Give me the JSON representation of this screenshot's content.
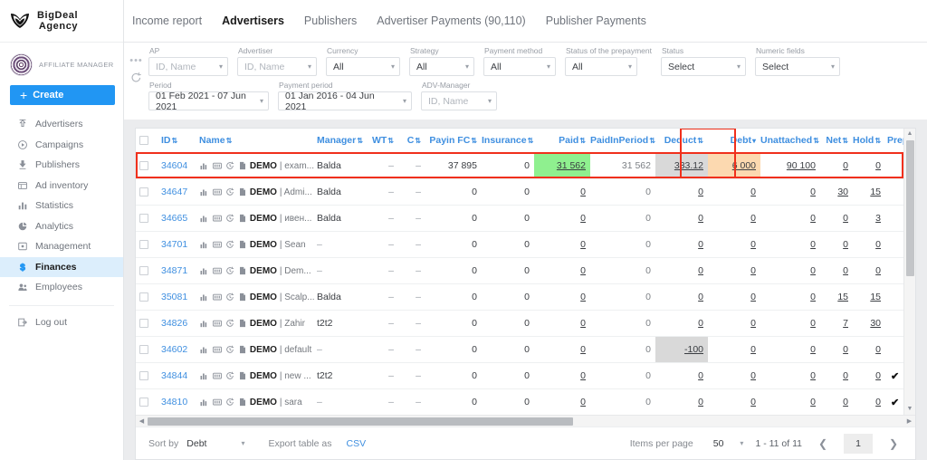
{
  "brand": {
    "line1": "BigDeal",
    "line2": "Agency",
    "logo_icon": "shield-logo-icon"
  },
  "account": {
    "role_label": "AFFILIATE MANAGER",
    "avatar_icon": "user-avatar-icon"
  },
  "sidebar": {
    "create_label": "Create",
    "items": [
      {
        "label": "Advertisers",
        "icon": "advertisers-icon"
      },
      {
        "label": "Campaigns",
        "icon": "campaigns-play-icon"
      },
      {
        "label": "Publishers",
        "icon": "publishers-icon"
      },
      {
        "label": "Ad inventory",
        "icon": "ad-inventory-icon"
      },
      {
        "label": "Statistics",
        "icon": "statistics-bars-icon"
      },
      {
        "label": "Analytics",
        "icon": "analytics-pie-icon"
      },
      {
        "label": "Management",
        "icon": "management-icon"
      },
      {
        "label": "Finances",
        "icon": "finances-dollar-icon"
      },
      {
        "label": "Employees",
        "icon": "employees-icon"
      }
    ],
    "logout_label": "Log out",
    "logout_icon": "logout-icon"
  },
  "topbar": {
    "tabs": [
      {
        "label": "Income report"
      },
      {
        "label": "Advertisers"
      },
      {
        "label": "Publishers"
      },
      {
        "label": "Advertiser Payments (90,110)"
      },
      {
        "label": "Publisher Payments"
      }
    ],
    "active_index": 1
  },
  "filters": {
    "more_icon": "three-dots-icon",
    "reset_icon": "reset-refresh-icon",
    "row1": [
      {
        "label": "AP",
        "value": "ID, Name",
        "placeholder": true,
        "w": "w-ap"
      },
      {
        "label": "Advertiser",
        "value": "ID, Name",
        "placeholder": true,
        "w": "w-adv"
      },
      {
        "label": "Currency",
        "value": "All",
        "placeholder": false,
        "w": "w-cur"
      },
      {
        "label": "Strategy",
        "value": "All",
        "placeholder": false,
        "w": "w-str"
      },
      {
        "label": "Payment method",
        "value": "All",
        "placeholder": false,
        "w": "w-pm"
      },
      {
        "label": "Status of the prepayment",
        "value": "All",
        "placeholder": false,
        "w": "w-sop"
      },
      {
        "label": "Status",
        "value": "Select",
        "placeholder": false,
        "w": "w-st"
      },
      {
        "label": "Numeric fields",
        "value": "Select",
        "placeholder": false,
        "w": "w-nf"
      }
    ],
    "row2": [
      {
        "label": "Period",
        "value": "01 Feb 2021 - 07 Jun 2021",
        "placeholder": false,
        "w": "w-per"
      },
      {
        "label": "Payment period",
        "value": "01 Jan 2016 - 04 Jun 2021",
        "placeholder": false,
        "w": "w-pper"
      },
      {
        "label": "ADV-Manager",
        "value": "ID, Name",
        "placeholder": true,
        "w": "w-adm"
      }
    ]
  },
  "table": {
    "columns": [
      {
        "key": "checkbox",
        "label": "",
        "sortable": false
      },
      {
        "key": "id",
        "label": "ID",
        "sortable": true
      },
      {
        "key": "name",
        "label": "Name",
        "sortable": true
      },
      {
        "key": "manager",
        "label": "Manager",
        "sortable": true
      },
      {
        "key": "wt",
        "label": "WT",
        "sortable": true
      },
      {
        "key": "c",
        "label": "C",
        "sortable": true
      },
      {
        "key": "payinfc",
        "label": "Payin FC",
        "sortable": true
      },
      {
        "key": "insurance",
        "label": "Insurance",
        "sortable": true
      },
      {
        "key": "paid",
        "label": "Paid",
        "sortable": true
      },
      {
        "key": "paidinper",
        "label": "PaidInPeriod",
        "sortable": true
      },
      {
        "key": "deduct",
        "label": "Deduct",
        "sortable": true
      },
      {
        "key": "debt",
        "label": "Debt",
        "sortable": "desc"
      },
      {
        "key": "unattached",
        "label": "Unattached",
        "sortable": true
      },
      {
        "key": "net",
        "label": "Net",
        "sortable": true
      },
      {
        "key": "hold",
        "label": "Hold",
        "sortable": true
      },
      {
        "key": "prepay",
        "label": "Prepay",
        "sortable": true
      }
    ],
    "row_icons": [
      "chart-bars-icon",
      "counter-box-icon",
      "history-clock-icon",
      "document-icon"
    ],
    "rows": [
      {
        "id": "34604",
        "demo": "DEMO",
        "name": "| exam...",
        "manager": "Balda",
        "wt": "–",
        "c": "–",
        "payinfc": "37 895",
        "insurance": "0",
        "paid": "31 562",
        "paidinper": "31 562",
        "deduct": "333.12",
        "debt": "6 000",
        "unattached": "90 100",
        "net": "0",
        "hold": "0",
        "prepay": "",
        "paid_bg": "green",
        "deduct_bg": "gray",
        "debt_bg": "orange",
        "highlight": true
      },
      {
        "id": "34647",
        "demo": "DEMO",
        "name": "| Admi...",
        "manager": "Balda",
        "wt": "–",
        "c": "–",
        "payinfc": "0",
        "insurance": "0",
        "paid": "0",
        "paidinper": "0",
        "deduct": "0",
        "debt": "0",
        "unattached": "0",
        "net": "30",
        "hold": "15",
        "prepay": ""
      },
      {
        "id": "34665",
        "demo": "DEMO",
        "name": "| ивен...",
        "manager": "Balda",
        "wt": "–",
        "c": "–",
        "payinfc": "0",
        "insurance": "0",
        "paid": "0",
        "paidinper": "0",
        "deduct": "0",
        "debt": "0",
        "unattached": "0",
        "net": "0",
        "hold": "3",
        "prepay": ""
      },
      {
        "id": "34701",
        "demo": "DEMO",
        "name": "| Sean",
        "manager": "–",
        "wt": "–",
        "c": "–",
        "payinfc": "0",
        "insurance": "0",
        "paid": "0",
        "paidinper": "0",
        "deduct": "0",
        "debt": "0",
        "unattached": "0",
        "net": "0",
        "hold": "0",
        "prepay": ""
      },
      {
        "id": "34871",
        "demo": "DEMO",
        "name": "| Dem...",
        "manager": "–",
        "wt": "–",
        "c": "–",
        "payinfc": "0",
        "insurance": "0",
        "paid": "0",
        "paidinper": "0",
        "deduct": "0",
        "debt": "0",
        "unattached": "0",
        "net": "0",
        "hold": "0",
        "prepay": ""
      },
      {
        "id": "35081",
        "demo": "DEMO",
        "name": "| Scalp...",
        "manager": "Balda",
        "wt": "–",
        "c": "–",
        "payinfc": "0",
        "insurance": "0",
        "paid": "0",
        "paidinper": "0",
        "deduct": "0",
        "debt": "0",
        "unattached": "0",
        "net": "15",
        "hold": "15",
        "prepay": ""
      },
      {
        "id": "34826",
        "demo": "DEMO",
        "name": "| Zahir",
        "manager": "t2t2",
        "wt": "–",
        "c": "–",
        "payinfc": "0",
        "insurance": "0",
        "paid": "0",
        "paidinper": "0",
        "deduct": "0",
        "debt": "0",
        "unattached": "0",
        "net": "7",
        "hold": "30",
        "prepay": ""
      },
      {
        "id": "34602",
        "demo": "DEMO",
        "name": "| default",
        "manager": "–",
        "wt": "–",
        "c": "–",
        "payinfc": "0",
        "insurance": "0",
        "paid": "0",
        "paidinper": "0",
        "deduct": "-100",
        "debt": "0",
        "unattached": "0",
        "net": "0",
        "hold": "0",
        "prepay": "",
        "deduct_bg": "gray"
      },
      {
        "id": "34844",
        "demo": "DEMO",
        "name": "| new ...",
        "manager": "t2t2",
        "wt": "–",
        "c": "–",
        "payinfc": "0",
        "insurance": "0",
        "paid": "0",
        "paidinper": "0",
        "deduct": "0",
        "debt": "0",
        "unattached": "0",
        "net": "0",
        "hold": "0",
        "prepay": "✔"
      },
      {
        "id": "34810",
        "demo": "DEMO",
        "name": "| sara",
        "manager": "–",
        "wt": "–",
        "c": "–",
        "payinfc": "0",
        "insurance": "0",
        "paid": "0",
        "paidinper": "0",
        "deduct": "0",
        "debt": "0",
        "unattached": "0",
        "net": "0",
        "hold": "0",
        "prepay": "✔"
      }
    ]
  },
  "footer": {
    "sort_by_label": "Sort by",
    "sort_by_value": "Debt",
    "export_label": "Export table as",
    "export_format": "CSV",
    "items_per_page_label": "Items per page",
    "items_per_page_value": "50",
    "range_text": "1 - 11 of 11",
    "page_number": "1",
    "prev_icon": "chevron-left-icon",
    "next_icon": "chevron-right-icon"
  },
  "colors": {
    "accent": "#2196f3",
    "header_link": "#3f8fe0",
    "highlight_red": "#f0301c",
    "cell_green": "#8ff08f",
    "cell_gray": "#d9d9d9",
    "cell_orange": "#fcd9b0"
  }
}
